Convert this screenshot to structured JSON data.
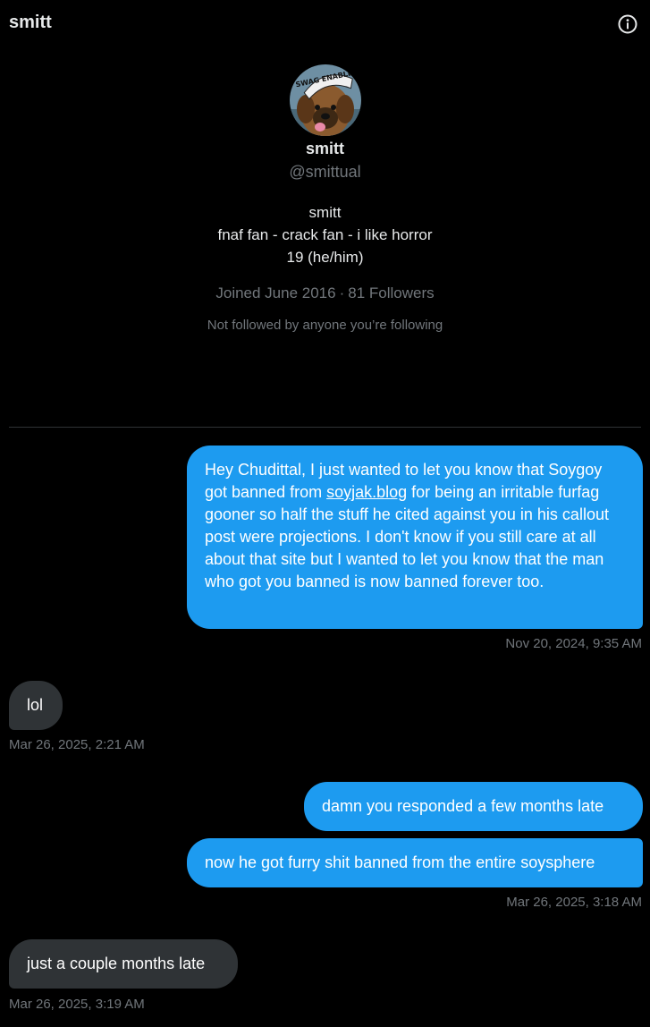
{
  "header": {
    "title": "smitt",
    "info_icon": "info-icon"
  },
  "profile": {
    "avatar_icon": "avatar-dog",
    "avatar_sign_text": "SWAG ENABLER",
    "name": "smitt",
    "handle": "@smittual",
    "bio_lines": [
      "smitt",
      "fnaf fan - crack fan - i like horror",
      "19 (he/him)"
    ],
    "joined": "Joined June 2016",
    "separator": "·",
    "followers": "81 Followers",
    "not_followed": "Not followed by anyone you’re following"
  },
  "messages": [
    {
      "sender": "me",
      "text_before": "Hey Chudittal, I just wanted to let you know that Soygoy got banned from ",
      "link": "soyjak.blog",
      "text_after": " for being an irritable furfag gooner so half the stuff he cited against you in his callout post were projections. I don't know if you still care at all about that site but I wanted to let you know that the man who got you banned is now banned forever too.",
      "timestamp": "Nov 20, 2024, 9:35 AM"
    },
    {
      "sender": "them",
      "text": "lol",
      "timestamp": "Mar 26, 2025, 2:21 AM"
    },
    {
      "sender": "me",
      "text": "damn you responded a few months late"
    },
    {
      "sender": "me",
      "text": "now he got furry shit banned from the entire soysphere",
      "timestamp": "Mar 26, 2025, 3:18 AM"
    },
    {
      "sender": "them",
      "text": "just a couple months late",
      "timestamp": "Mar 26, 2025, 3:19 AM"
    }
  ],
  "colors": {
    "sent_bubble": "#1d9bf0",
    "received_bubble": "#2f3336",
    "muted_text": "#71767b",
    "background": "#000000"
  }
}
